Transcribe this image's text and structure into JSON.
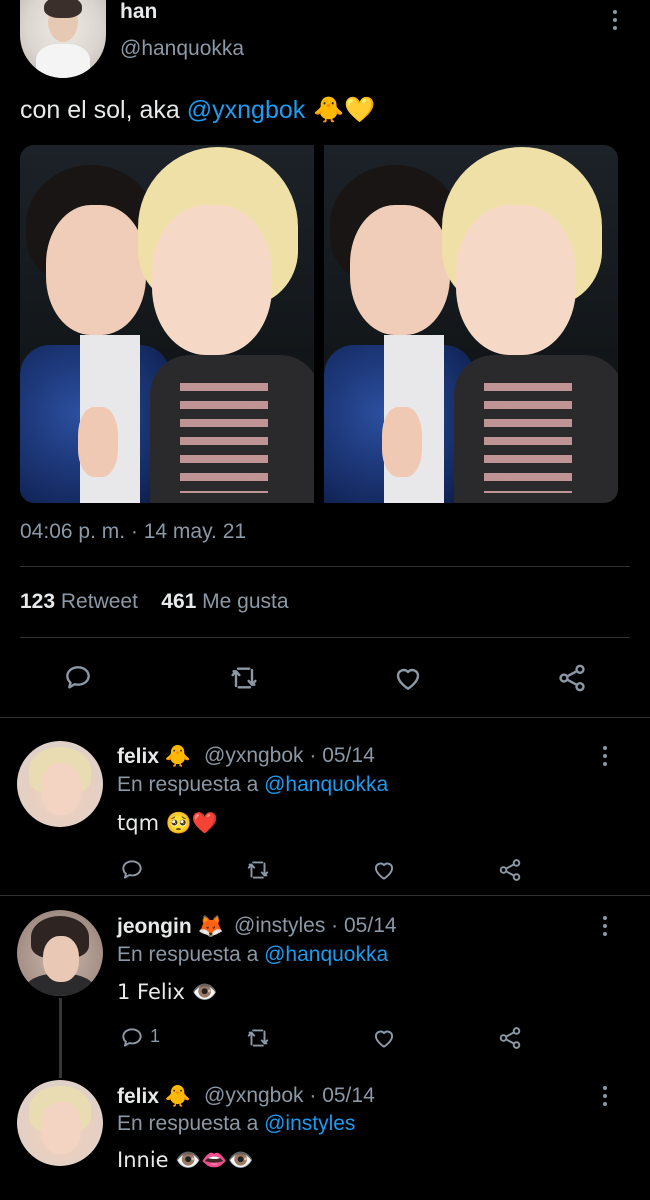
{
  "tweet": {
    "name": "han",
    "handle": "@hanquokka",
    "text_prefix": "con el sol, aka ",
    "text_mention": "@yxngbok",
    "text_suffix": " 🐥💛",
    "timestamp": "04:06 p. m. · 14 may. 21",
    "retweet_count": "123",
    "retweet_label": "Retweet",
    "like_count": "461",
    "like_label": "Me gusta"
  },
  "replies": [
    {
      "name": "felix",
      "emoji": "🐥",
      "meta": "@yxngbok · 05/14",
      "reply_prefix": "En respuesta a ",
      "reply_to": "@hanquokka",
      "text": "tqm 🥺❤️",
      "reply_count": ""
    },
    {
      "name": "jeongin",
      "emoji": "🦊",
      "meta": "@instyles · 05/14",
      "reply_prefix": "En respuesta a ",
      "reply_to": "@hanquokka",
      "text": "1 Felix 👁️",
      "reply_count": "1"
    },
    {
      "name": "felix",
      "emoji": "🐥",
      "meta": "@yxngbok · 05/14",
      "reply_prefix": "En respuesta a ",
      "reply_to": "@instyles",
      "text": "Innie 👁️👄👁️",
      "reply_count": ""
    }
  ],
  "colors": {
    "background": "#000000",
    "text": "#e7e9ea",
    "secondary": "#8b98a5",
    "accent": "#1d9bf0",
    "divider": "#2f3336"
  },
  "icons": [
    "reply-icon",
    "retweet-icon",
    "like-icon",
    "share-icon",
    "more-icon"
  ]
}
